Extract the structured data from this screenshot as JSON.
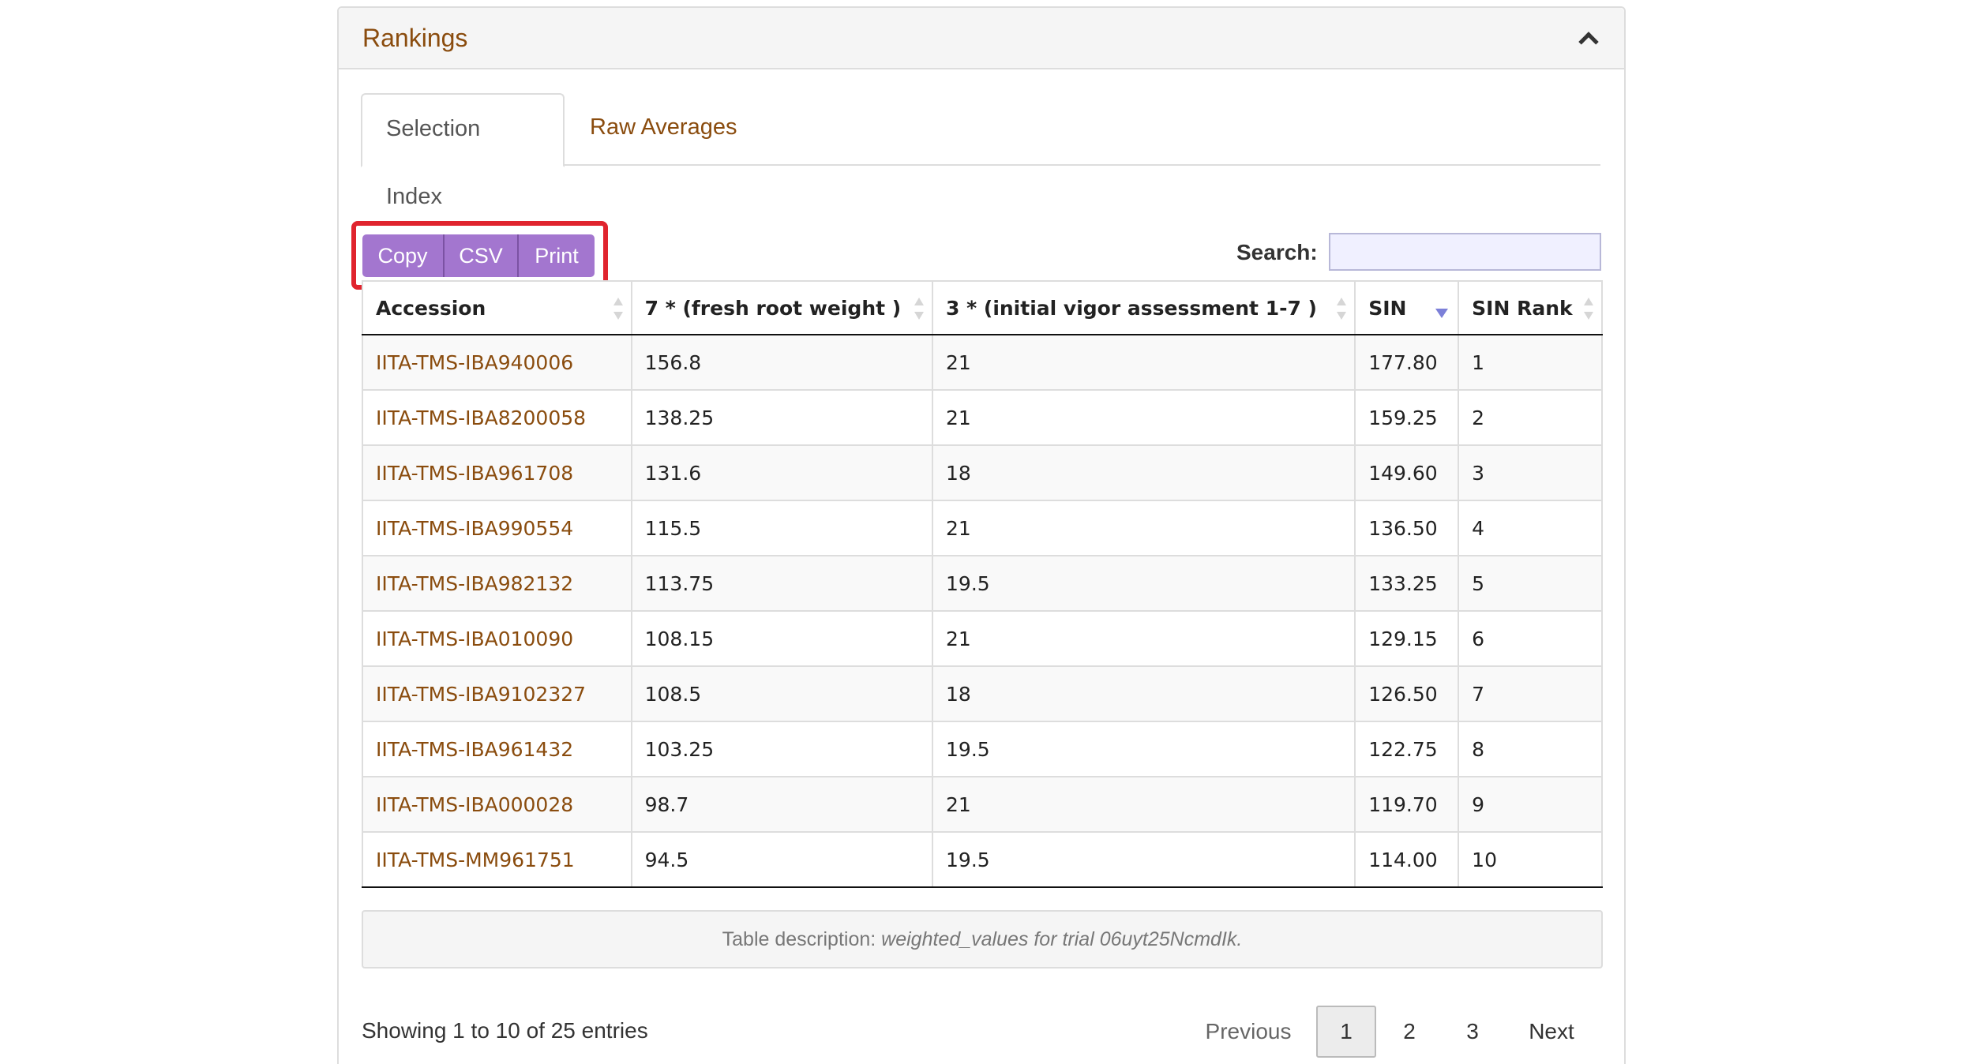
{
  "panel": {
    "title": "Rankings"
  },
  "tabs": [
    {
      "label": "Selection Index",
      "active": true
    },
    {
      "label": "Raw Averages",
      "active": false
    }
  ],
  "buttons": {
    "copy": "Copy",
    "csv": "CSV",
    "print": "Print"
  },
  "search": {
    "label": "Search:",
    "value": ""
  },
  "table": {
    "headers": [
      "Accession",
      "7 * (fresh root weight )",
      "3 * (initial vigor assessment 1-7 )",
      "SIN",
      "SIN Rank"
    ],
    "sorted_column": "SIN",
    "sort_direction": "descending",
    "rows": [
      [
        "IITA-TMS-IBA940006",
        "156.8",
        "21",
        "177.80",
        "1"
      ],
      [
        "IITA-TMS-IBA8200058",
        "138.25",
        "21",
        "159.25",
        "2"
      ],
      [
        "IITA-TMS-IBA961708",
        "131.6",
        "18",
        "149.60",
        "3"
      ],
      [
        "IITA-TMS-IBA990554",
        "115.5",
        "21",
        "136.50",
        "4"
      ],
      [
        "IITA-TMS-IBA982132",
        "113.75",
        "19.5",
        "133.25",
        "5"
      ],
      [
        "IITA-TMS-IBA010090",
        "108.15",
        "21",
        "129.15",
        "6"
      ],
      [
        "IITA-TMS-IBA9102327",
        "108.5",
        "18",
        "126.50",
        "7"
      ],
      [
        "IITA-TMS-IBA961432",
        "103.25",
        "19.5",
        "122.75",
        "8"
      ],
      [
        "IITA-TMS-IBA000028",
        "98.7",
        "21",
        "119.70",
        "9"
      ],
      [
        "IITA-TMS-MM961751",
        "94.5",
        "19.5",
        "114.00",
        "10"
      ]
    ]
  },
  "caption": {
    "prefix": "Table description: ",
    "text": "weighted_values for trial 06uyt25NcmdIk."
  },
  "info": "Showing 1 to 10 of 25 entries",
  "pagination": {
    "previous": "Previous",
    "pages": [
      "1",
      "2",
      "3"
    ],
    "current": "1",
    "next": "Next"
  },
  "colors": {
    "link": "#8a4c0e",
    "button": "#a376cf",
    "highlight": "#e0242e",
    "sort_indicator": "#7c80d8"
  }
}
